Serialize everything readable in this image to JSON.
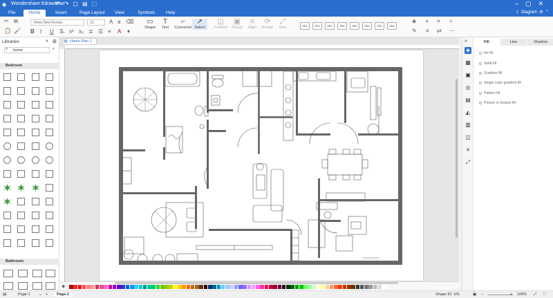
{
  "app": {
    "title": "Wondershare EdrawMax"
  },
  "menu": {
    "items": [
      "File",
      "Home",
      "Insert",
      "Page Layout",
      "View",
      "Symbols",
      "Help"
    ],
    "active": "Home",
    "user": "Diagram"
  },
  "ribbon": {
    "font_name": "Times New Roman",
    "font_size": "12",
    "tools": [
      {
        "label": "Shape",
        "glyph": "▭"
      },
      {
        "label": "Text",
        "glyph": "T"
      },
      {
        "label": "Connector",
        "glyph": "⌐"
      },
      {
        "label": "Select",
        "glyph": "➚"
      },
      {
        "label": "Position",
        "glyph": "◫"
      },
      {
        "label": "Group",
        "glyph": "▣"
      },
      {
        "label": "Align",
        "glyph": "≡"
      },
      {
        "label": "Rotate",
        "glyph": "⟳"
      },
      {
        "label": "Size",
        "glyph": "⤢"
      }
    ],
    "style_label": "Abc"
  },
  "left_panel": {
    "title": "Libraries",
    "search_value": "home",
    "categories": [
      "Bedroom",
      "Bathroom"
    ]
  },
  "canvas": {
    "tab_label": "Home Plan 1"
  },
  "right_panel": {
    "tabs": [
      "Fill",
      "Line",
      "Shadow"
    ],
    "active_tab": "Fill",
    "fill_options": [
      "No fill",
      "Solid fill",
      "Gradient fill",
      "Single color gradient fill",
      "Pattern fill",
      "Picture or texture fill"
    ]
  },
  "status": {
    "page_selector": "Page-1",
    "page_tab": "Page-1",
    "add_page": "+",
    "shape_id": "Shape ID: 101",
    "zoom": "100%"
  },
  "colors": {
    "brand": "#2b6fce",
    "wall": "#666666",
    "swatches": [
      "#c00000",
      "#e03030",
      "#ff0000",
      "#ff5050",
      "#ff8080",
      "#ff9999",
      "#cc3366",
      "#e0507a",
      "#ff66cc",
      "#cc0099",
      "#9900cc",
      "#6600cc",
      "#3333cc",
      "#0066cc",
      "#0099ff",
      "#33ccff",
      "#00cccc",
      "#009999",
      "#00cc99",
      "#00cc66",
      "#33cc33",
      "#66cc00",
      "#99cc00",
      "#cccc00",
      "#ffff00",
      "#ffcc00",
      "#ff9900",
      "#ff6600",
      "#cc6600",
      "#996633",
      "#663300",
      "#330000",
      "#003366",
      "#006699",
      "#0099cc",
      "#66ccff",
      "#99ccff",
      "#ccccff",
      "#9999ff",
      "#6666ff",
      "#9966ff",
      "#cc99ff",
      "#ff99ff",
      "#ff66ff",
      "#ff3399",
      "#ff0066",
      "#cc0033",
      "#990033",
      "#660033",
      "#330033",
      "#003300",
      "#006600",
      "#009900",
      "#00cc00",
      "#66ff66",
      "#99ff99",
      "#ccffcc",
      "#ffffcc",
      "#ffff99",
      "#ffcc99",
      "#ff9966",
      "#ff6633",
      "#ff3300",
      "#cc3300",
      "#993300",
      "#663300",
      "#333333",
      "#555555",
      "#777777",
      "#999999",
      "#bbbbbb",
      "#dddddd",
      "#ffffff"
    ]
  }
}
